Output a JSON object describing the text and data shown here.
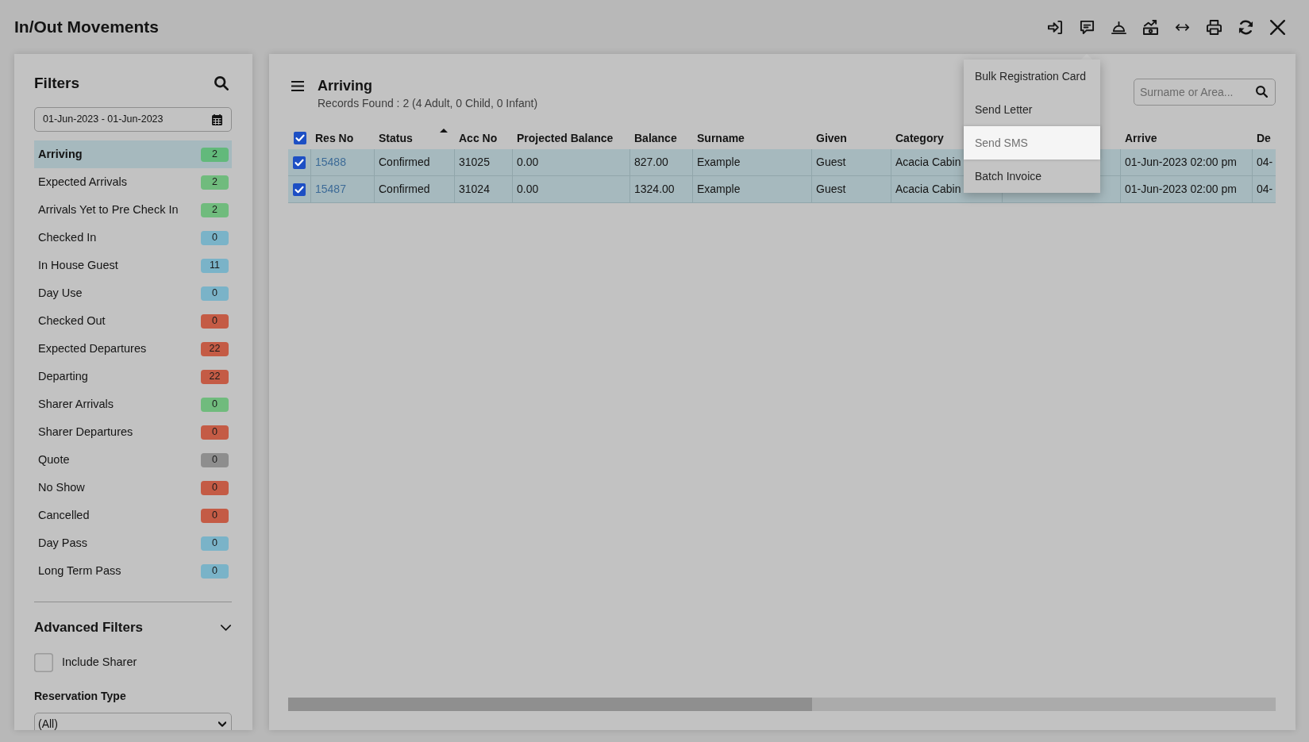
{
  "window": {
    "title": "In/Out Movements"
  },
  "filters": {
    "title": "Filters",
    "date_range": "01-Jun-2023 - 01-Jun-2023",
    "items": [
      {
        "label": "Arriving",
        "count": "2",
        "color": "#62b97b",
        "selected": true
      },
      {
        "label": "Expected Arrivals",
        "count": "2",
        "color": "#70bb7d",
        "selected": false
      },
      {
        "label": "Arrivals Yet to Pre Check In",
        "count": "2",
        "color": "#70bb7d",
        "selected": false
      },
      {
        "label": "Checked In",
        "count": "0",
        "color": "#7ab3c8",
        "selected": false
      },
      {
        "label": "In House Guest",
        "count": "11",
        "color": "#7ab3c8",
        "selected": false
      },
      {
        "label": "Day Use",
        "count": "0",
        "color": "#7ab3c8",
        "selected": false
      },
      {
        "label": "Checked Out",
        "count": "0",
        "color": "#c45b45",
        "selected": false
      },
      {
        "label": "Expected Departures",
        "count": "22",
        "color": "#c45b45",
        "selected": false
      },
      {
        "label": "Departing",
        "count": "22",
        "color": "#c45b45",
        "selected": false
      },
      {
        "label": "Sharer Arrivals",
        "count": "0",
        "color": "#70bb7d",
        "selected": false
      },
      {
        "label": "Sharer Departures",
        "count": "0",
        "color": "#c45b45",
        "selected": false
      },
      {
        "label": "Quote",
        "count": "0",
        "color": "#8e8e8e",
        "selected": false
      },
      {
        "label": "No Show",
        "count": "0",
        "color": "#c45b45",
        "selected": false
      },
      {
        "label": "Cancelled",
        "count": "0",
        "color": "#c45b45",
        "selected": false
      },
      {
        "label": "Day Pass",
        "count": "0",
        "color": "#7ab3c8",
        "selected": false
      },
      {
        "label": "Long Term Pass",
        "count": "0",
        "color": "#7ab3c8",
        "selected": false
      }
    ],
    "advanced": {
      "title": "Advanced Filters",
      "include_sharer": {
        "label": "Include Sharer",
        "checked": false
      },
      "reservation_type": {
        "label": "Reservation Type",
        "value": "(All)"
      }
    }
  },
  "list": {
    "title": "Arriving",
    "summary": "Records Found : 2 (4 Adult, 0 Child, 0 Infant)",
    "search": {
      "placeholder": "Surname or Area..."
    },
    "table": {
      "all_checked": true,
      "columns": [
        {
          "label": "Res No",
          "kind": "link",
          "sorted": false
        },
        {
          "label": "Status",
          "kind": "text",
          "sorted": true
        },
        {
          "label": "Acc No",
          "kind": "text",
          "sorted": false
        },
        {
          "label": "Projected Balance",
          "kind": "text",
          "sorted": false
        },
        {
          "label": "Balance",
          "kind": "text",
          "sorted": false
        },
        {
          "label": "Surname",
          "kind": "text",
          "sorted": false
        },
        {
          "label": "Given",
          "kind": "text",
          "sorted": false
        },
        {
          "label": "Category",
          "kind": "text",
          "sorted": false
        },
        null,
        {
          "label": "Arrive",
          "kind": "text",
          "sorted": false
        },
        {
          "label": "De",
          "kind": "text",
          "sorted": false
        }
      ],
      "rows": [
        {
          "checked": true,
          "selected": true,
          "cells": [
            "15488",
            "Confirmed",
            "31025",
            "0.00",
            "827.00",
            "Example",
            "Guest",
            "Acacia Cabin",
            null,
            "01-Jun-2023 02:00 pm",
            "04-"
          ]
        },
        {
          "checked": true,
          "selected": true,
          "cells": [
            "15487",
            "Confirmed",
            "31024",
            "0.00",
            "1324.00",
            "Example",
            "Guest",
            "Acacia Cabin",
            null,
            "01-Jun-2023 02:00 pm",
            "04-"
          ]
        }
      ]
    }
  },
  "actions_menu": {
    "items": [
      {
        "label": "Bulk Registration Card",
        "selected": false
      },
      {
        "label": "Send Letter",
        "selected": false
      },
      {
        "label": "Send SMS",
        "selected": true
      },
      {
        "label": "Batch Invoice",
        "selected": false
      }
    ]
  }
}
